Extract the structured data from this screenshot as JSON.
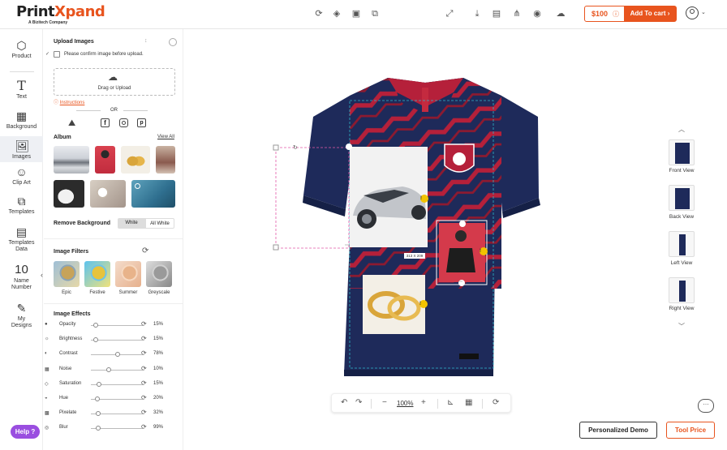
{
  "brand": {
    "name_a": "Print",
    "name_b": "Xpand",
    "tagline": "A Bizitech Company"
  },
  "header": {
    "price": "$100",
    "add_to_cart": "Add To cart"
  },
  "nav": [
    {
      "label": "Product"
    },
    {
      "label": "Text"
    },
    {
      "label": "Background"
    },
    {
      "label": "Images"
    },
    {
      "label": "Clip Art"
    },
    {
      "label": "Templates"
    },
    {
      "label": "Templates Data"
    },
    {
      "label": "Name Number",
      "icon_text": "10"
    },
    {
      "label": "My Designs"
    }
  ],
  "help": "Help",
  "panel": {
    "upload_title": "Upload Images",
    "confirm_label": "Please confirm image before upload.",
    "drag_upload": "Drag or Upload",
    "instructions": "Instructions",
    "or": "OR",
    "album_title": "Album",
    "view_all": "View All",
    "remove_bg": "Remove Background",
    "remove_white": "White",
    "remove_all_white": "All White",
    "filters_title": "Image Filters",
    "filters": [
      "Epic",
      "Festive",
      "Summer",
      "Greyscale"
    ],
    "effects_title": "Image Effects",
    "effects": [
      {
        "name": "Opacity",
        "value": "15%",
        "level": 0.05
      },
      {
        "name": "Brightness",
        "value": "15%",
        "level": 0.05
      },
      {
        "name": "Contrast",
        "value": "78%",
        "level": 0.5
      },
      {
        "name": "Noise",
        "value": "10%",
        "level": 0.32
      },
      {
        "name": "Saturation",
        "value": "15%",
        "level": 0.12
      },
      {
        "name": "Hue",
        "value": "20%",
        "level": 0.08
      },
      {
        "name": "Pixelate",
        "value": "32%",
        "level": 0.1
      },
      {
        "name": "Blur",
        "value": "99%",
        "level": 0.1
      }
    ]
  },
  "canvas": {
    "size_label": "313 X 209",
    "views": [
      {
        "label": "Front View"
      },
      {
        "label": "Back View"
      },
      {
        "label": "Left View"
      },
      {
        "label": "Right View"
      }
    ],
    "zoom": "100%"
  },
  "footer": {
    "demo": "Personalized Demo",
    "tool_price": "Tool Price"
  },
  "colors": {
    "accent": "#e8541e",
    "jersey": "#1e2a5a",
    "jersey_red": "#b5203a",
    "help": "#9a4ee0"
  }
}
